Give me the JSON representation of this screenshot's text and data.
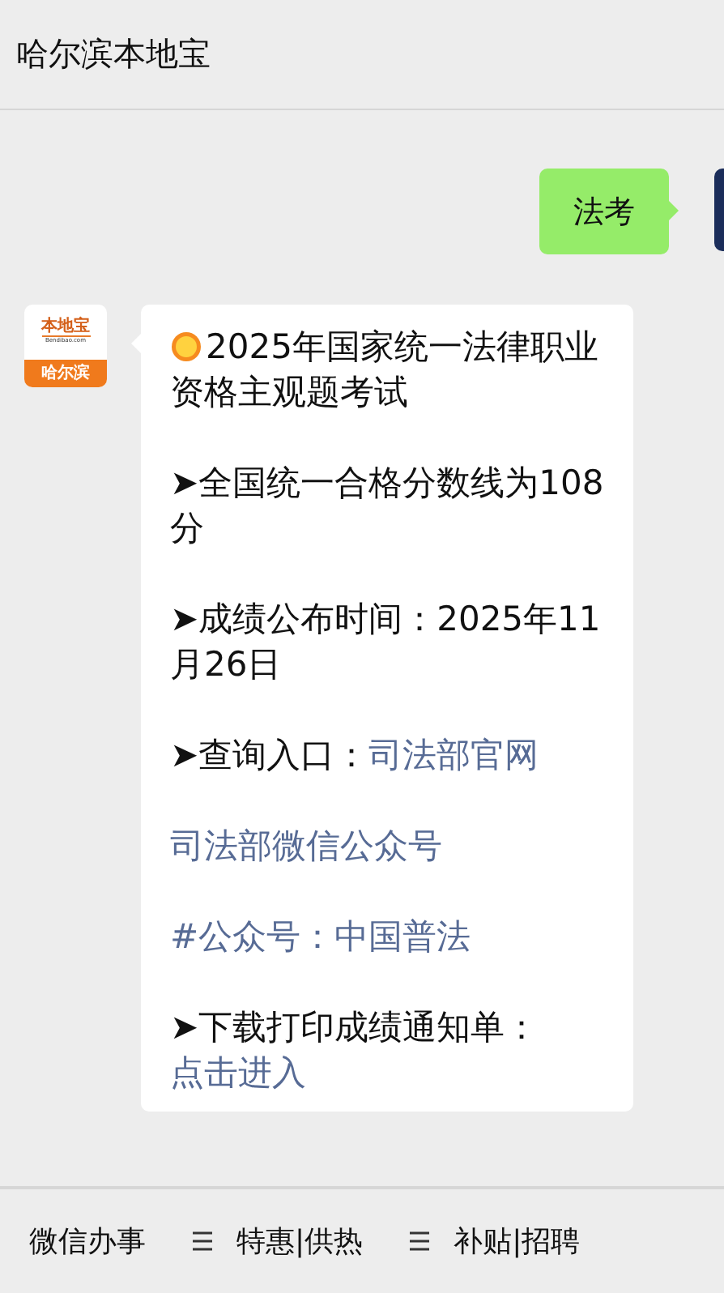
{
  "header": {
    "title": "哈尔滨本地宝"
  },
  "messages": [
    {
      "kind": "sent",
      "text": "法考"
    },
    {
      "kind": "received",
      "avatar": {
        "brand": "本地宝",
        "domain": "Bendibao.com",
        "city": "哈尔滨"
      },
      "paragraphs": [
        {
          "kind": "sun",
          "text": "2025年国家统一法律职业资格主观题考试"
        },
        {
          "kind": "plain",
          "text": "➤全国统一合格分数线为108分"
        },
        {
          "kind": "plain",
          "text": "➤成绩公布时间：2025年11月26日"
        },
        {
          "kind": "plain",
          "text": "➤查询入口：",
          "link": "司法部官网"
        },
        {
          "kind": "plain",
          "link": "司法部微信公众号"
        },
        {
          "kind": "plain",
          "link": "#公众号：中国普法"
        },
        {
          "kind": "plain",
          "text": "➤下载打印成绩通知单：",
          "link": "点击进入"
        }
      ]
    }
  ],
  "menu": [
    {
      "label": "微信办事",
      "has_menu_icon": false
    },
    {
      "label": "特惠|供热",
      "has_menu_icon": true
    },
    {
      "label": "补贴|招聘",
      "has_menu_icon": true
    }
  ]
}
